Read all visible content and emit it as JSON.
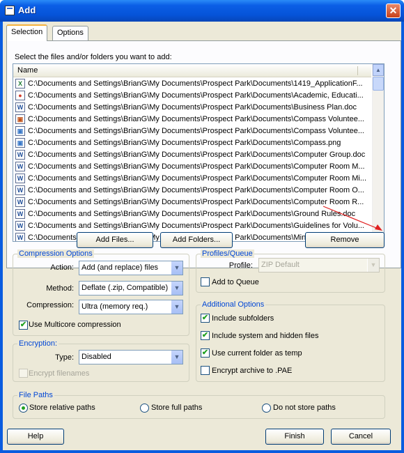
{
  "window": {
    "title": "Add",
    "close_glyph": "✕"
  },
  "tabs": [
    {
      "label": "Selection",
      "active": true
    },
    {
      "label": "Options",
      "active": false
    }
  ],
  "selection": {
    "instruction": "Select the files and/or folders you want to add:",
    "column_name": "Name",
    "files": [
      {
        "icon": "excel-file-icon",
        "glyph": "X",
        "color": "#1e7b34",
        "path": "C:\\Documents and Settings\\BrianG\\My Documents\\Prospect Park\\Documents\\1419_ApplicationF..."
      },
      {
        "icon": "chrome-shortcut-icon",
        "glyph": "●",
        "color": "#d33b2c",
        "path": "C:\\Documents and Settings\\BrianG\\My Documents\\Prospect Park\\Documents\\Academic, Educati..."
      },
      {
        "icon": "word-file-icon",
        "glyph": "W",
        "color": "#1f4e99",
        "path": "C:\\Documents and Settings\\BrianG\\My Documents\\Prospect Park\\Documents\\Business Plan.doc"
      },
      {
        "icon": "image-file-icon",
        "glyph": "▣",
        "color": "#c2541a",
        "path": "C:\\Documents and Settings\\BrianG\\My Documents\\Prospect Park\\Documents\\Compass Voluntee..."
      },
      {
        "icon": "image-file-icon",
        "glyph": "▣",
        "color": "#3a79c9",
        "path": "C:\\Documents and Settings\\BrianG\\My Documents\\Prospect Park\\Documents\\Compass Voluntee..."
      },
      {
        "icon": "png-file-icon",
        "glyph": "▣",
        "color": "#3a79c9",
        "path": "C:\\Documents and Settings\\BrianG\\My Documents\\Prospect Park\\Documents\\Compass.png"
      },
      {
        "icon": "word-file-icon",
        "glyph": "W",
        "color": "#1f4e99",
        "path": "C:\\Documents and Settings\\BrianG\\My Documents\\Prospect Park\\Documents\\Computer Group.doc"
      },
      {
        "icon": "word-file-icon",
        "glyph": "W",
        "color": "#1f4e99",
        "path": "C:\\Documents and Settings\\BrianG\\My Documents\\Prospect Park\\Documents\\Computer Room M..."
      },
      {
        "icon": "word-file-icon",
        "glyph": "W",
        "color": "#1f4e99",
        "path": "C:\\Documents and Settings\\BrianG\\My Documents\\Prospect Park\\Documents\\Computer Room Mi..."
      },
      {
        "icon": "word-file-icon",
        "glyph": "W",
        "color": "#1f4e99",
        "path": "C:\\Documents and Settings\\BrianG\\My Documents\\Prospect Park\\Documents\\Computer Room O..."
      },
      {
        "icon": "word-file-icon",
        "glyph": "W",
        "color": "#1f4e99",
        "path": "C:\\Documents and Settings\\BrianG\\My Documents\\Prospect Park\\Documents\\Computer Room R..."
      },
      {
        "icon": "word-file-icon",
        "glyph": "W",
        "color": "#1f4e99",
        "path": "C:\\Documents and Settings\\BrianG\\My Documents\\Prospect Park\\Documents\\Ground Rules.doc"
      },
      {
        "icon": "word-file-icon",
        "glyph": "W",
        "color": "#1f4e99",
        "path": "C:\\Documents and Settings\\BrianG\\My Documents\\Prospect Park\\Documents\\Guidelines for Volu..."
      },
      {
        "icon": "word-file-icon",
        "glyph": "W",
        "color": "#1f4e99",
        "path": "C:\\Documents and Settings\\BrianG\\My Documents\\Prospect Park\\Documents\\Minut..."
      }
    ],
    "add_files_label": "Add Files...",
    "add_folders_label": "Add Folders...",
    "remove_label": "Remove"
  },
  "compression_options": {
    "title": "Compression Options",
    "action_label": "Action:",
    "action_value": "Add (and replace) files",
    "method_label": "Method:",
    "method_value": "Deflate (.zip, Compatible)",
    "compression_label": "Compression:",
    "compression_value": "Ultra (memory req.)",
    "multicore_label": "Use Multicore compression",
    "multicore_checked": true
  },
  "profiles_queue": {
    "title": "Profiles/Queue",
    "profile_label": "Profile:",
    "profile_value": "ZIP Default",
    "add_to_queue_label": "Add to Queue",
    "add_to_queue_checked": false
  },
  "additional_options": {
    "title": "Additional Options",
    "items": [
      {
        "label": "Include subfolders",
        "checked": true
      },
      {
        "label": "Include system and hidden files",
        "checked": true
      },
      {
        "label": "Use current folder as temp",
        "checked": true
      },
      {
        "label": "Encrypt archive to .PAE",
        "checked": false
      }
    ]
  },
  "encryption": {
    "title": "Encryption:",
    "type_label": "Type:",
    "type_value": "Disabled",
    "encrypt_filenames_label": "Encrypt filenames",
    "encrypt_filenames_checked": false
  },
  "file_paths": {
    "title": "File Paths",
    "options": [
      {
        "label": "Store relative paths",
        "selected": true
      },
      {
        "label": "Store full paths",
        "selected": false
      },
      {
        "label": "Do not store paths",
        "selected": false
      }
    ]
  },
  "footer": {
    "help_label": "Help",
    "finish_label": "Finish",
    "cancel_label": "Cancel"
  },
  "colors": {
    "accent": "#0046d5",
    "check": "#21a121",
    "arrow": "#e02020"
  }
}
